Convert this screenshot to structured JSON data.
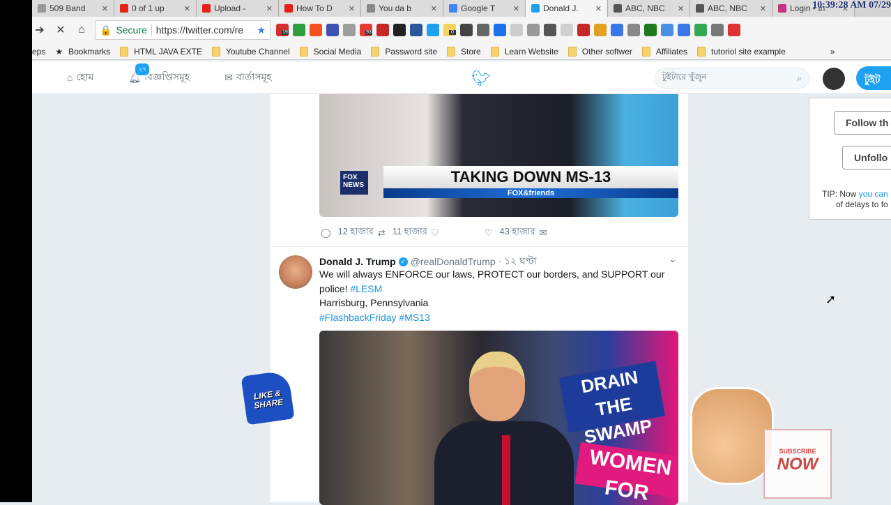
{
  "browser": {
    "tabs": [
      {
        "title": "509 Band",
        "icon": "page",
        "color": "#999999"
      },
      {
        "title": "0 of 1 up",
        "icon": "youtube",
        "color": "#e62117"
      },
      {
        "title": "Upload -",
        "icon": "youtube",
        "color": "#e62117"
      },
      {
        "title": "How To D",
        "icon": "youtube",
        "color": "#e62117"
      },
      {
        "title": "You da b",
        "icon": "page",
        "color": "#888888"
      },
      {
        "title": "Google T",
        "icon": "google",
        "color": "#4285f4"
      },
      {
        "title": "Donald J.",
        "icon": "twitter",
        "color": "#1da1f2",
        "active": true
      },
      {
        "title": "ABC, NBC",
        "icon": "th",
        "color": "#555555"
      },
      {
        "title": "ABC, NBC",
        "icon": "th",
        "color": "#555555"
      },
      {
        "title": "Login • In",
        "icon": "instagram",
        "color": "#c13584"
      }
    ],
    "clock": "10:39:28 AM 07/29",
    "secure_label": "Secure",
    "url": "https://twitter.com/re",
    "extension_badges": [
      "19",
      "93",
      "0"
    ],
    "bookmarks": [
      "eps",
      "Bookmarks",
      "HTML JAVA EXTE",
      "Youtube Channel",
      "Social Media",
      "Password site",
      "Store",
      "Learn Website",
      "Other softwer",
      "Affiliates",
      "tutoriol site example"
    ],
    "bookmarks_more": "»"
  },
  "twitter": {
    "nav": [
      {
        "label": "হোম",
        "icon": "home"
      },
      {
        "label": "বিজ্ঞপ্তিসমূহ",
        "icon": "bell",
        "badge": "২৭"
      },
      {
        "label": "বার্তাসমূহ",
        "icon": "envelope"
      }
    ],
    "search_placeholder": "টুইটারে খুঁজুন",
    "tweet_button": "টুইট",
    "tweet1": {
      "chyron": "TAKING DOWN MS-13",
      "band": "FOX&friends",
      "logo": "FOX NEWS",
      "replies": "12 হাজার",
      "retweets": "11 হাজার",
      "likes": "43 হাজার"
    },
    "tweet2": {
      "name": "Donald J. Trump",
      "handle": "@realDonaldTrump",
      "time": "· ১২ ঘণ্টা",
      "text": "We will always ENFORCE our laws, PROTECT our borders, and SUPPORT our police!",
      "hashtag1": "#LESM",
      "location": "Harrisburg, Pennsylvania",
      "hashtags2": "#FlashbackFriday #MS13",
      "sign1": "DRAIN THE SWAMP",
      "sign2": "WOMEN FOR"
    },
    "panel": {
      "follow": "Follow th",
      "unfollow": "Unfollo",
      "tip_prefix": "TIP: Now ",
      "tip_link": "you can",
      "tip_line2": "of delays to fo"
    }
  },
  "overlays": {
    "like_share": "LIKE & SHARE",
    "subscribe_small": "SUBSCRIBE",
    "subscribe_big": "NOW"
  }
}
